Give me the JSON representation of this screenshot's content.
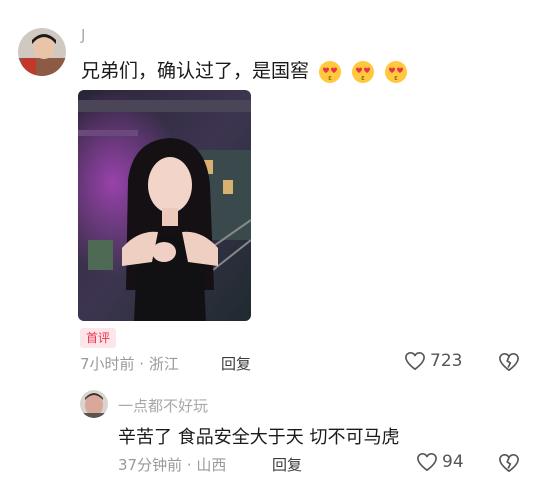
{
  "comment": {
    "username": "J",
    "text": "兄弟们，确认过了，是国窖",
    "emojis": [
      "heart-eyes-emoji",
      "heart-eyes-emoji",
      "heart-eyes-emoji"
    ],
    "badge": "首评",
    "time_location": "7小时前 · 浙江",
    "reply_label": "回复",
    "like_count": "723"
  },
  "sub_reply": {
    "username": "一点都不好玩",
    "text": "辛苦了 食品安全大于天 切不可马虎",
    "time_location": "37分钟前 · 山西",
    "reply_label": "回复",
    "like_count": "94"
  },
  "colors": {
    "badge_bg": "#fde6ea",
    "badge_text": "#f0314f",
    "meta_gray": "#9a9a9a"
  }
}
